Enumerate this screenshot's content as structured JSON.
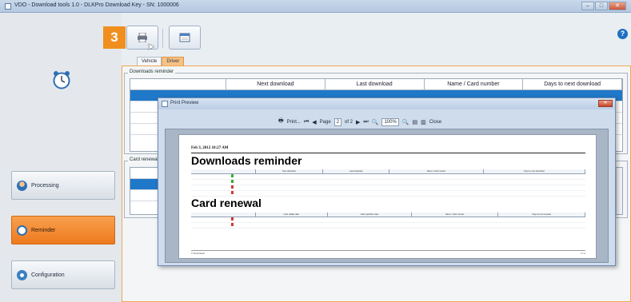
{
  "window": {
    "title": "VDO - Download tools 1.0 - DLKPro Download Key - SN: 1000006",
    "minimize": "–",
    "maximize": "□",
    "close": "✕"
  },
  "toolbar": {
    "step_number": "3"
  },
  "help": {
    "label": "?"
  },
  "sidebar": {
    "items": [
      {
        "label": "Processing",
        "active": false,
        "icon": "processing-person-icon"
      },
      {
        "label": "Reminder",
        "active": true,
        "icon": "reminder-clock-icon"
      },
      {
        "label": "Configuration",
        "active": false,
        "icon": "configuration-gears-icon"
      }
    ]
  },
  "tabs": [
    {
      "label": "Vehicle",
      "selected": false
    },
    {
      "label": "Driver",
      "selected": true
    }
  ],
  "downloads_reminder": {
    "legend": "Downloads reminder",
    "columns": [
      "Next download",
      "Last download",
      "Name / Card number",
      "Days to next download"
    ]
  },
  "card_renewal": {
    "legend": "Card renewal"
  },
  "print_preview": {
    "title": "Print Preview",
    "close": "✕",
    "toolbar": {
      "print": "Print...",
      "page_label": "Page",
      "page": "2",
      "of_pages": "of 2",
      "zoom": "100%",
      "close": "Close"
    },
    "page": {
      "date": "Feb 3, 2012 10:27 AM",
      "section1_title": "Downloads reminder",
      "section1_columns": [
        "Next download",
        "Last download",
        "Name / Card number",
        "Days to next download"
      ],
      "section2_title": "Card renewal",
      "section2_columns": [
        "Card validity date",
        "Card expiration date",
        "Name / Card number",
        "Days to next renewal"
      ],
      "footer_left": "© Download",
      "footer_right": "2 / 2"
    }
  },
  "colors": {
    "accent": "#f08f1f",
    "selection": "#1f78c8",
    "help": "#1f6fc1"
  }
}
